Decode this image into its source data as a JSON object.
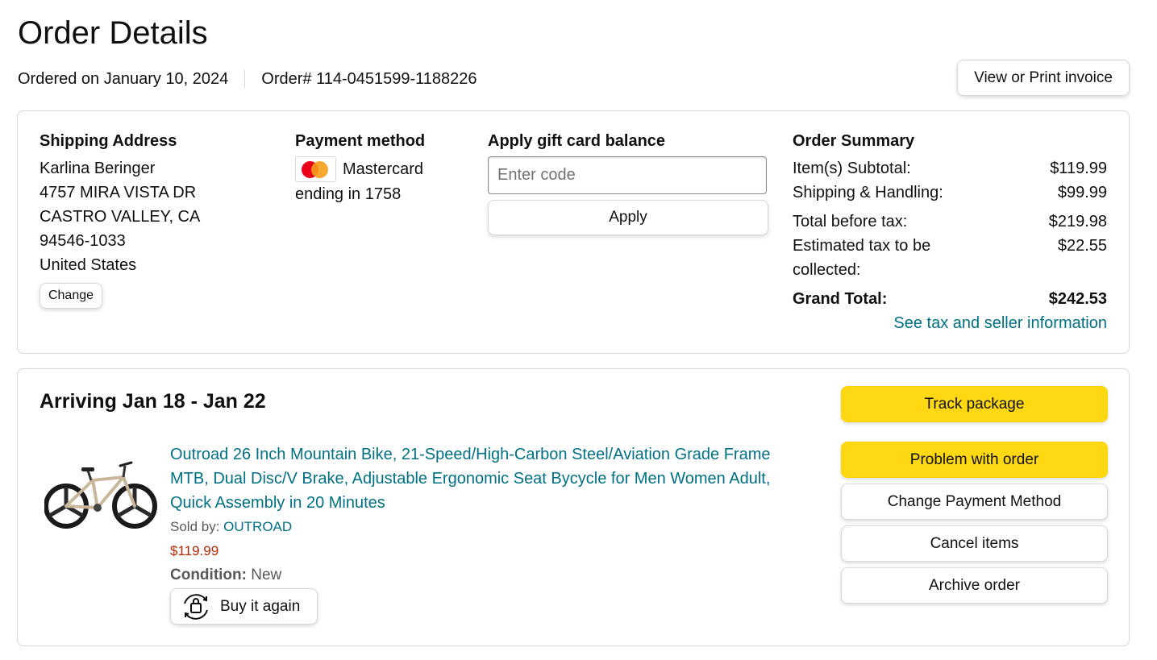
{
  "page": {
    "title": "Order Details"
  },
  "meta": {
    "ordered_on": "Ordered on January 10, 2024",
    "order_number": "Order# 114-0451599-1188226",
    "invoice_button": "View or Print invoice"
  },
  "shipping": {
    "title": "Shipping Address",
    "name": "Karlina Beringer",
    "street": "4757 MIRA VISTA DR",
    "city_state": "CASTRO VALLEY, CA",
    "zip": "94546-1033",
    "country": "United States",
    "change_button": "Change"
  },
  "payment": {
    "title": "Payment method",
    "card_brand": "Mastercard",
    "card_ending": "ending in 1758",
    "card_icon": "mastercard-icon"
  },
  "gift": {
    "title": "Apply gift card balance",
    "placeholder": "Enter code",
    "value": "",
    "apply_button": "Apply"
  },
  "summary": {
    "title": "Order Summary",
    "subtotal_label": "Item(s) Subtotal:",
    "subtotal_value": "$119.99",
    "shipping_label": "Shipping & Handling:",
    "shipping_value": "$99.99",
    "before_tax_label": "Total before tax:",
    "before_tax_value": "$219.98",
    "tax_label": "Estimated tax to be collected:",
    "tax_value": "$22.55",
    "grand_label": "Grand Total:",
    "grand_value": "$242.53",
    "tax_link": "See tax and seller information"
  },
  "shipment": {
    "arriving": "Arriving Jan 18 - Jan 22",
    "product_title": "Outroad 26 Inch Mountain Bike, 21-Speed/High-Carbon Steel/Aviation Grade Frame MTB, Dual Disc/V Brake, Adjustable Ergonomic Seat Bycycle for Men Women Adult, Quick Assembly in 20 Minutes",
    "sold_by_label": "Sold by: ",
    "seller": "OUTROAD",
    "price": "$119.99",
    "condition_label": "Condition:",
    "condition_value": "New",
    "buy_again": "Buy it again",
    "actions": {
      "track": "Track package",
      "problem": "Problem with order",
      "change_payment": "Change Payment Method",
      "cancel": "Cancel items",
      "archive": "Archive order"
    }
  },
  "colors": {
    "link": "#007185",
    "price": "#B12704",
    "primary_button": "#FFD814",
    "border": "#D5D9D9"
  }
}
